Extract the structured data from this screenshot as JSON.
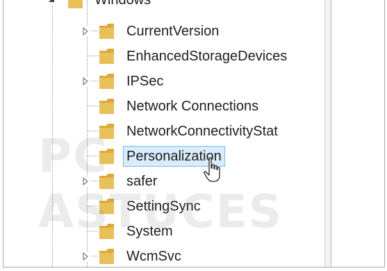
{
  "colors": {
    "folder_body": "#e8c05a",
    "folder_front": "#f3d57a",
    "selection_bg": "#d9ecfb",
    "selection_border": "#7fb9e6",
    "tree_lines": "#9a9a9a"
  },
  "parent_key": {
    "label": "Windows",
    "icon": "folder-icon",
    "expanded": true
  },
  "tree": {
    "items": [
      {
        "label": "CurrentVersion",
        "has_children": true
      },
      {
        "label": "EnhancedStorageDevices",
        "has_children": false
      },
      {
        "label": "IPSec",
        "has_children": true
      },
      {
        "label": "Network Connections",
        "has_children": false
      },
      {
        "label": "NetworkConnectivityStat",
        "has_children": false
      },
      {
        "label": "Personalization",
        "has_children": false,
        "selected": true
      },
      {
        "label": "safer",
        "has_children": true
      },
      {
        "label": "SettingSync",
        "has_children": false
      },
      {
        "label": "System",
        "has_children": false
      },
      {
        "label": "WcmSvc",
        "has_children": true
      }
    ]
  },
  "watermark": {
    "text": "PC ASTUCES"
  }
}
